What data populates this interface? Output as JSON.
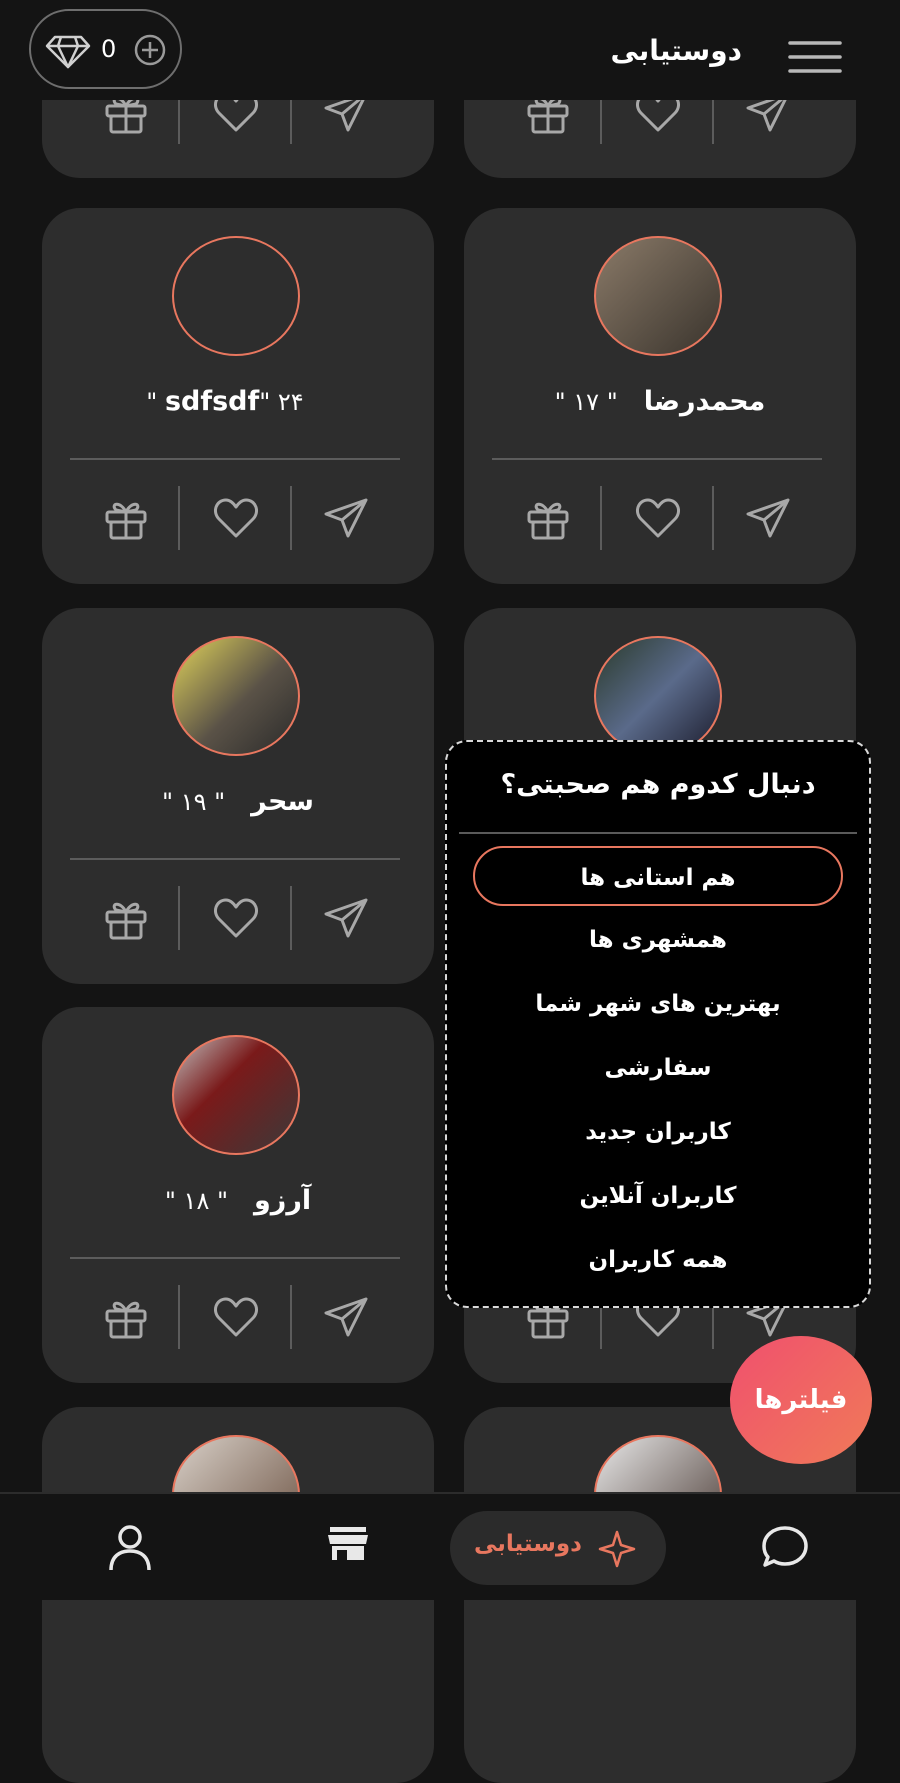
{
  "header": {
    "title": "دوستیابی",
    "gem_count": "0"
  },
  "cards": [
    {
      "name": "",
      "age": ""
    },
    {
      "name": "",
      "age": ""
    },
    {
      "name": "sdfsdf",
      "age": "\" ۲۴ \""
    },
    {
      "name": "محمدرضا",
      "age": "\" ۱۷ \""
    },
    {
      "name": "سحر",
      "age": "\" ۱۹ \""
    },
    {
      "name": "",
      "age": ""
    },
    {
      "name": "آرزو",
      "age": "\" ۱۸ \""
    },
    {
      "name": "",
      "age": ""
    }
  ],
  "filter_popup": {
    "title": "دنبال کدوم هم صحبتی؟",
    "options": [
      "هم استانی ها",
      "همشهری ها",
      "بهترین های شهر شما",
      "سفارشی",
      "کاربران جدید",
      "کاربران آنلاین",
      "همه کاربران"
    ],
    "selected_index": 0
  },
  "fab": {
    "label": "فیلترها"
  },
  "bottom_nav": {
    "active_label": "دوستیابی",
    "items": [
      "profile-icon",
      "shop-icon",
      "sparkle-icon",
      "chat-icon"
    ]
  },
  "colors": {
    "accent": "#e8775f",
    "fab_gradient_start": "#f0506e",
    "fab_gradient_end": "#f07a58",
    "card_bg": "#2d2d2d",
    "page_bg": "#141414"
  }
}
